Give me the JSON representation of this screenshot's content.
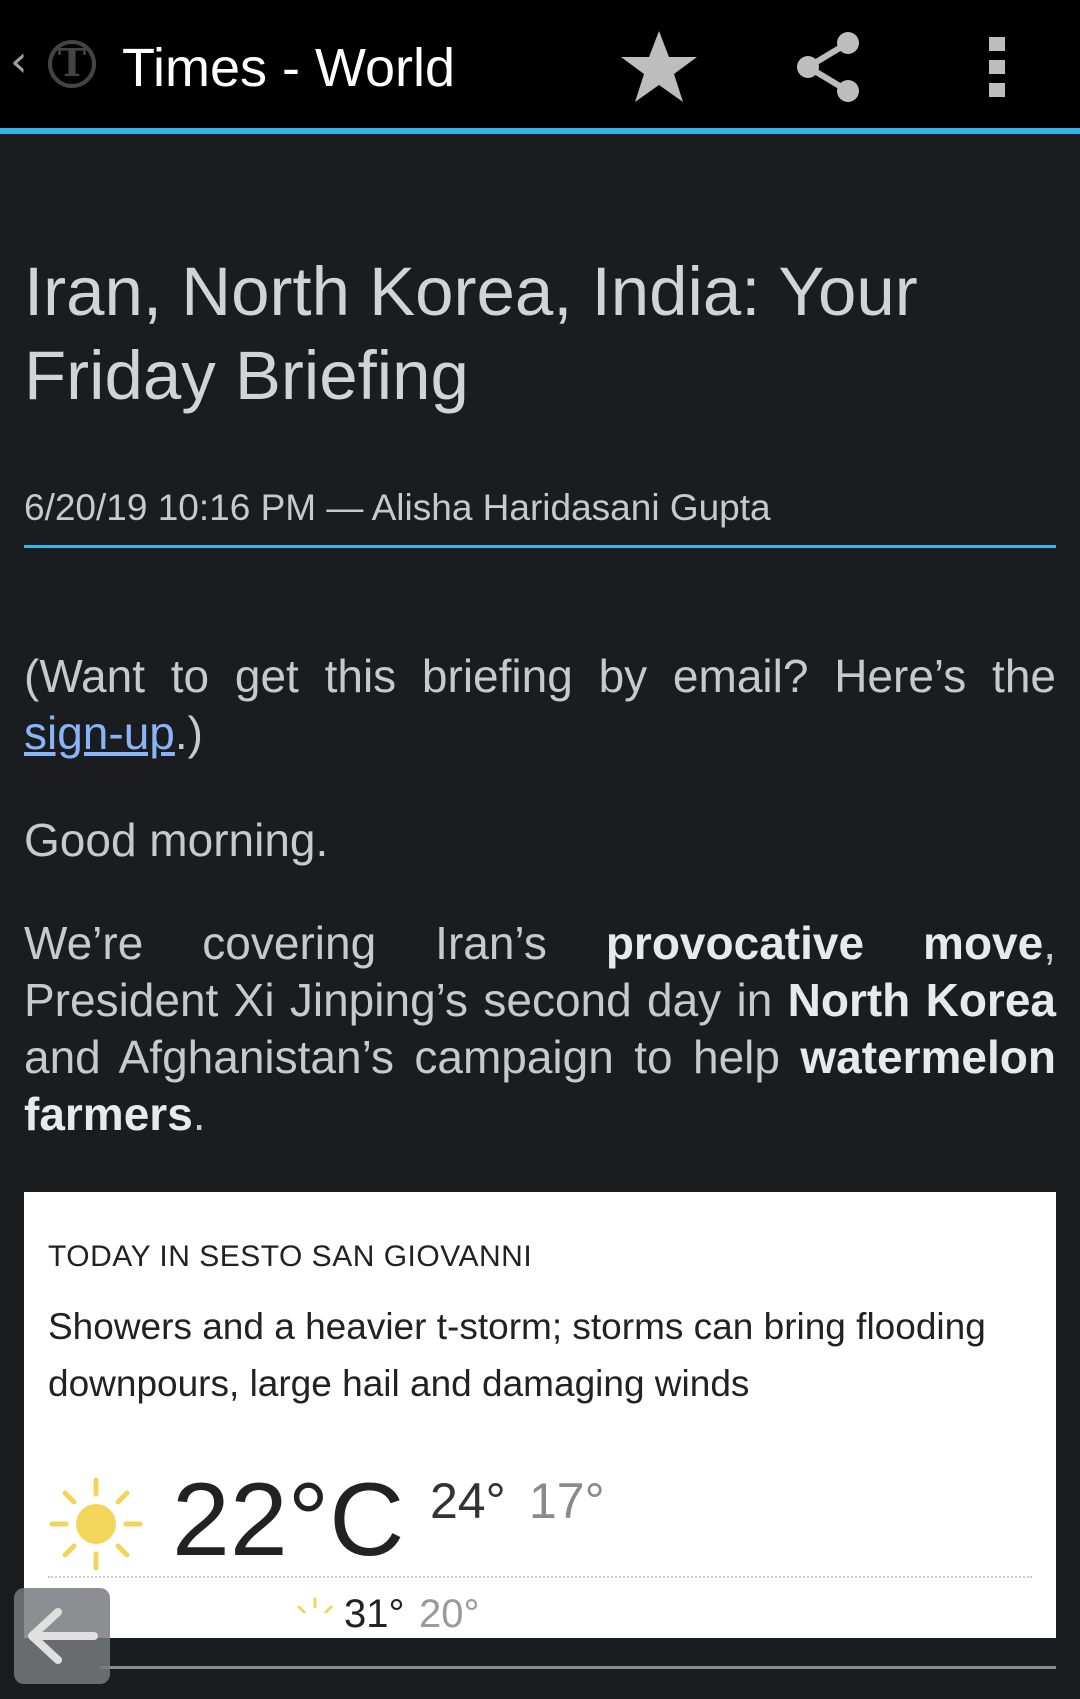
{
  "appbar": {
    "title": "Times - World",
    "icons": {
      "up": "chevron-left-icon",
      "logo": "nyt-logo-icon",
      "favorite": "star-icon",
      "share": "share-icon",
      "overflow": "more-vert-icon"
    },
    "accent_color": "#33b5e5"
  },
  "article": {
    "headline": "Iran, North Korea, India: Your Friday Briefing",
    "byline": "6/20/19 10:16 PM — Alisha Haridasani Gupta",
    "p1_before_link": "(Want to get this briefing by email? Here’s the ",
    "p1_link": "sign-up",
    "p1_after_link": ".)",
    "p2": "Good morning.",
    "p3_a": "We’re covering Iran’s ",
    "p3_b1": "provocative move",
    "p3_c": ", President Xi Jinping’s second day in ",
    "p3_b2": "North Korea",
    "p3_d": " and Afghanistan’s campaign to help ",
    "p3_b3": "watermelon farmers",
    "p3_e": "."
  },
  "weather": {
    "title": "TODAY IN SESTO SAN GIOVANNI",
    "description": "Showers and a heavier t-storm; storms can bring flooding downpours, large hail and damaging winds",
    "icon": "sun-icon",
    "current_temp": "22°C",
    "high": "24°",
    "low": "17°",
    "next_high": "31°",
    "next_low": "20°"
  },
  "nav": {
    "back_icon": "arrow-left-icon"
  }
}
